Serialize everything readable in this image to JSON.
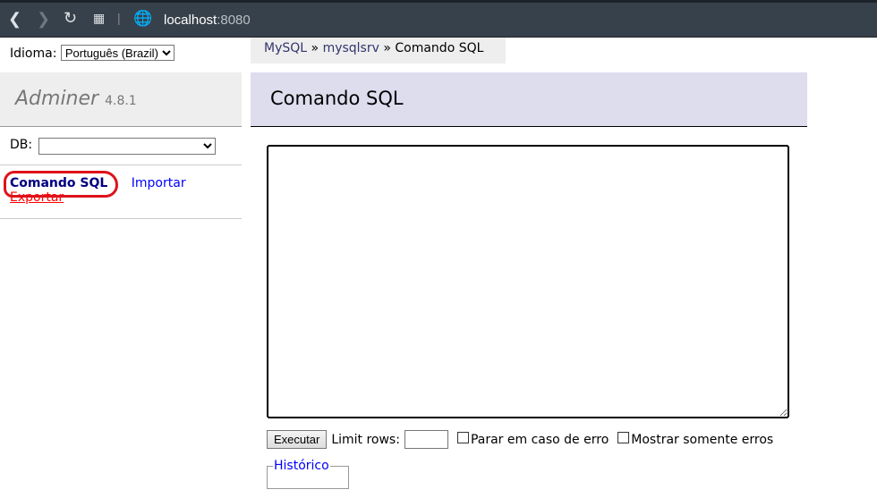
{
  "browser": {
    "url_host": "localhost",
    "url_port": ":8080",
    "icons": [
      "back-icon",
      "forward-icon",
      "reload-icon",
      "apps-icon",
      "globe-icon"
    ]
  },
  "sidebar": {
    "language_label": "Idioma:",
    "language_value": "Português (Brazil)",
    "app_name": "Adminer",
    "version": "4.8.1",
    "db_label": "DB:",
    "db_value": "",
    "links": [
      "Comando SQL",
      "Importar",
      "Exportar"
    ]
  },
  "breadcrumb": {
    "items": [
      "MySQL",
      "mysqlsrv"
    ],
    "current": "Comando SQL",
    "separator": "»"
  },
  "main": {
    "title": "Comando SQL",
    "sql_value": "",
    "execute_label": "Executar",
    "limit_label": "Limit rows:",
    "limit_value": "",
    "stop_on_error": "Parar em caso de erro",
    "only_errors": "Mostrar somente erros",
    "history_label": "Histórico"
  },
  "colors": {
    "annotation": "#e0121a",
    "header_bg": "#ddddee",
    "link": "#0000ff",
    "export_link": "#ff0000"
  }
}
